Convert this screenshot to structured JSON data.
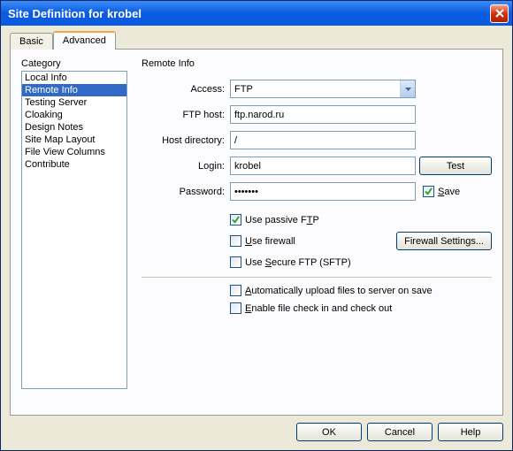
{
  "title": "Site Definition for krobel",
  "tabs": {
    "basic": "Basic",
    "advanced": "Advanced"
  },
  "category_label": "Category",
  "categories": {
    "local_info": "Local Info",
    "remote_info": "Remote Info",
    "testing_server": "Testing Server",
    "cloaking": "Cloaking",
    "design_notes": "Design Notes",
    "site_map_layout": "Site Map Layout",
    "file_view_columns": "File View Columns",
    "contribute": "Contribute"
  },
  "section_title": "Remote Info",
  "labels": {
    "access": "Access:",
    "ftp_host": "FTP host:",
    "host_dir": "Host directory:",
    "login": "Login:",
    "password": "Password:"
  },
  "values": {
    "access": "FTP",
    "ftp_host": "ftp.narod.ru",
    "host_dir": "/",
    "login": "krobel",
    "password": "•••••••"
  },
  "buttons": {
    "test": "Test",
    "firewall_settings": "Firewall Settings...",
    "ok": "OK",
    "cancel": "Cancel",
    "help": "Help"
  },
  "checkboxes": {
    "save": "Save",
    "passive_ftp": "Use passive FTP",
    "use_firewall": "Use firewall",
    "secure_ftp": "Use Secure FTP (SFTP)",
    "auto_upload": "Automatically upload files to server on save",
    "enable_checkinout": "Enable file check in and check out"
  },
  "underline": {
    "save": "S",
    "passive": "P",
    "firewall": "U",
    "secure": "S",
    "auto": "A",
    "enable": "E"
  }
}
